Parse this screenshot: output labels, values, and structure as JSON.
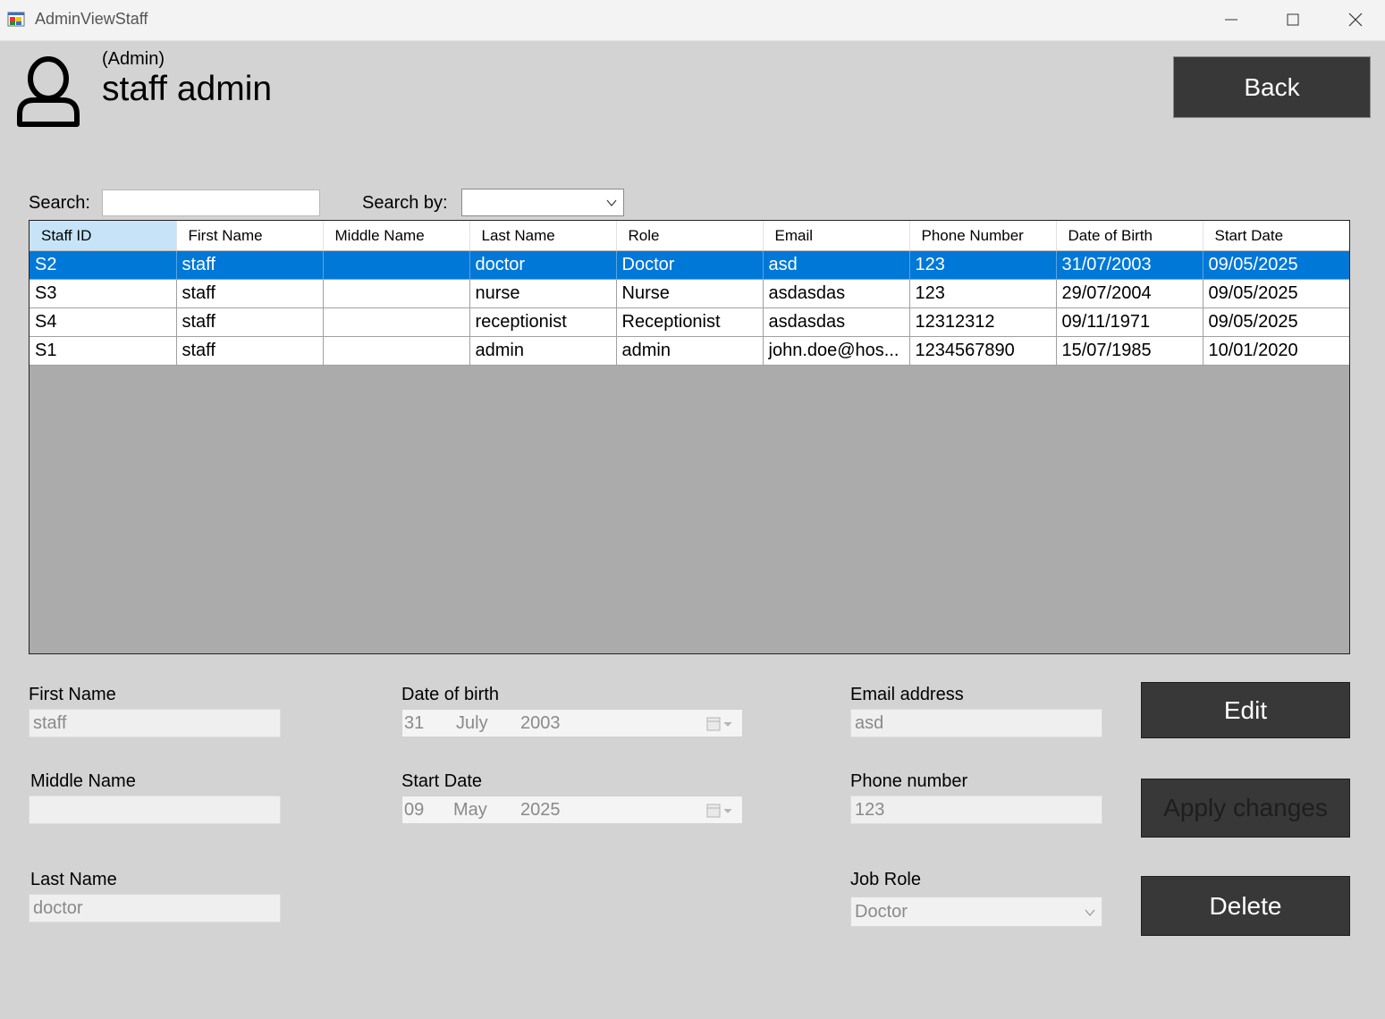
{
  "window": {
    "title": "AdminViewStaff"
  },
  "header": {
    "role_label": "(Admin)",
    "user_name": "staff admin",
    "back_label": "Back"
  },
  "search": {
    "label": "Search:",
    "value": "",
    "by_label": "Search by:",
    "by_value": ""
  },
  "grid": {
    "columns": [
      "Staff ID",
      "First Name",
      "Middle Name",
      "Last Name",
      "Role",
      "Email",
      "Phone Number",
      "Date of Birth",
      "Start Date"
    ],
    "rows": [
      [
        "S2",
        "staff",
        "",
        "doctor",
        "Doctor",
        "asd",
        "123",
        "31/07/2003",
        "09/05/2025"
      ],
      [
        "S3",
        "staff",
        "",
        "nurse",
        "Nurse",
        "asdasdas",
        "123",
        "29/07/2004",
        "09/05/2025"
      ],
      [
        "S4",
        "staff",
        "",
        "receptionist",
        "Receptionist",
        "asdasdas",
        "12312312",
        "09/11/1971",
        "09/05/2025"
      ],
      [
        "S1",
        "staff",
        "",
        "admin",
        "admin",
        "john.doe@hos...",
        "1234567890",
        "15/07/1985",
        "10/01/2020"
      ]
    ],
    "selected_row": 0
  },
  "form": {
    "first_name_label": "First Name",
    "first_name": "staff",
    "middle_name_label": "Middle Name",
    "middle_name": "",
    "last_name_label": "Last Name",
    "last_name": "doctor",
    "dob_label": "Date of birth",
    "dob_day": "31",
    "dob_month": "July",
    "dob_year": "2003",
    "start_label": "Start Date",
    "start_day": "09",
    "start_month": "May",
    "start_year": "2025",
    "email_label": "Email address",
    "email": "asd",
    "phone_label": "Phone number",
    "phone": "123",
    "role_label": "Job Role",
    "role": "Doctor"
  },
  "actions": {
    "edit": "Edit",
    "apply": "Apply changes",
    "delete": "Delete"
  },
  "colors": {
    "selection": "#0078d7",
    "button": "#383838",
    "background": "#d3d3d3"
  },
  "icons": [
    "app-icon",
    "minimize-icon",
    "maximize-icon",
    "close-icon",
    "user-icon",
    "chevron-down-icon",
    "calendar-icon"
  ]
}
